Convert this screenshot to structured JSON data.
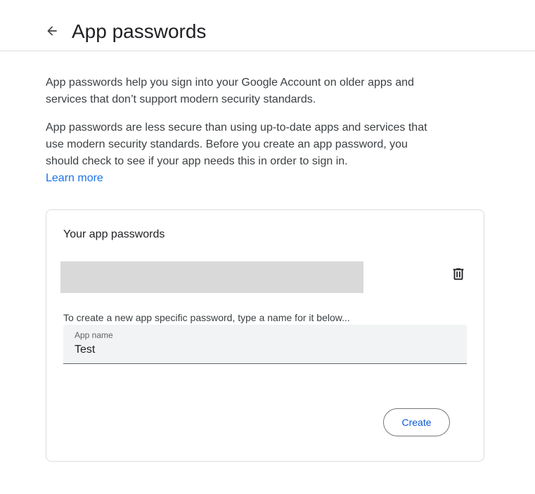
{
  "header": {
    "back_icon": "arrow-back-icon",
    "title": "App passwords"
  },
  "intro": {
    "paragraph1": "App passwords help you sign into your Google Account on older apps and services that don’t support modern security standards.",
    "paragraph2": "App passwords are less secure than using up-to-date apps and services that use modern security standards. Before you create an app password, you should check to see if your app needs this in order to sign in.",
    "learn_more": "Learn more"
  },
  "card": {
    "title": "Your app passwords",
    "delete_icon": "trash-icon",
    "create_hint": "To create a new app specific password, type a name for it below...",
    "app_name_field": {
      "label": "App name",
      "value": "Test"
    },
    "create_button": "Create"
  },
  "colors": {
    "link": "#1a73e8",
    "button_text": "#0b57d0",
    "border": "#dadce0",
    "field_bg": "#f1f3f4",
    "redacted": "#d9d9d9"
  }
}
